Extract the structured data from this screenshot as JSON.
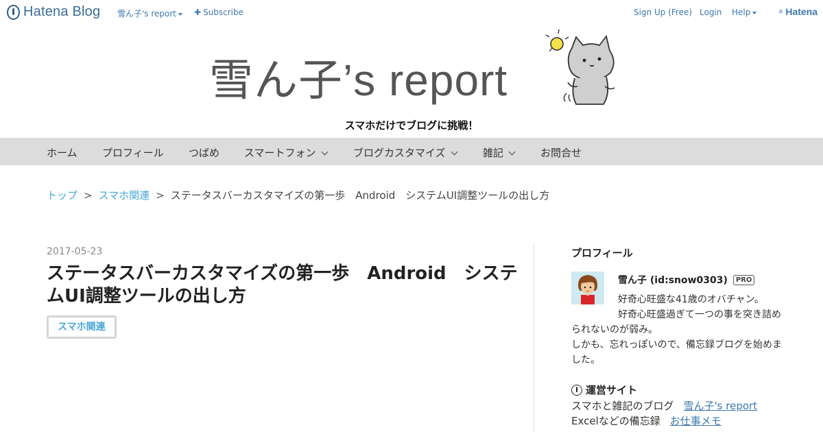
{
  "topbar": {
    "logo_text": "Hatena Blog",
    "blog_menu": "雪ん子's report",
    "subscribe": "Subscribe",
    "signup": "Sign Up (Free)",
    "login": "Login",
    "help": "Help",
    "hatena": "Hatena"
  },
  "header": {
    "title": "雪ん子’s report",
    "tagline": "スマホだけでブログに挑戦！"
  },
  "nav": {
    "items": [
      {
        "label": "ホーム",
        "dropdown": false
      },
      {
        "label": "プロフィール",
        "dropdown": false
      },
      {
        "label": "つばめ",
        "dropdown": false
      },
      {
        "label": "スマートフォン",
        "dropdown": true
      },
      {
        "label": "ブログカスタマイズ",
        "dropdown": true
      },
      {
        "label": "雑記",
        "dropdown": true
      },
      {
        "label": "お問合せ",
        "dropdown": false
      }
    ]
  },
  "breadcrumb": {
    "top": "トップ",
    "category": "スマホ関連",
    "separator": ">",
    "current": "ステータスバーカスタマイズの第一歩　Android　システムUI調整ツールの出し方"
  },
  "article": {
    "date": "2017-05-23",
    "title": "ステータスバーカスタマイズの第一歩　Android　システムUI調整ツールの出し方",
    "category": "スマホ関連"
  },
  "sidebar": {
    "profile_heading": "プロフィール",
    "name": "雪ん子 (id:snow0303)",
    "badge": "PRO",
    "desc_line1": "好奇心旺盛な41歳のオバチャン。",
    "desc_line2": "好奇心旺盛過ぎて一つの事を突き詰められないのが弱み。",
    "desc_line3": "しかも、忘れっぽいので、備忘録ブログを始めました。",
    "sites_heading": "運営サイト",
    "sites": [
      {
        "label": "スマホと雑記のブログ",
        "link": "雪ん子's report"
      },
      {
        "label": "Excelなどの備忘録",
        "link": "お仕事メモ"
      }
    ]
  },
  "colors": {
    "nav_bg": "#dcdcdc",
    "link_blue": "#3d78ae",
    "accent_cyan": "#48a8d6"
  }
}
